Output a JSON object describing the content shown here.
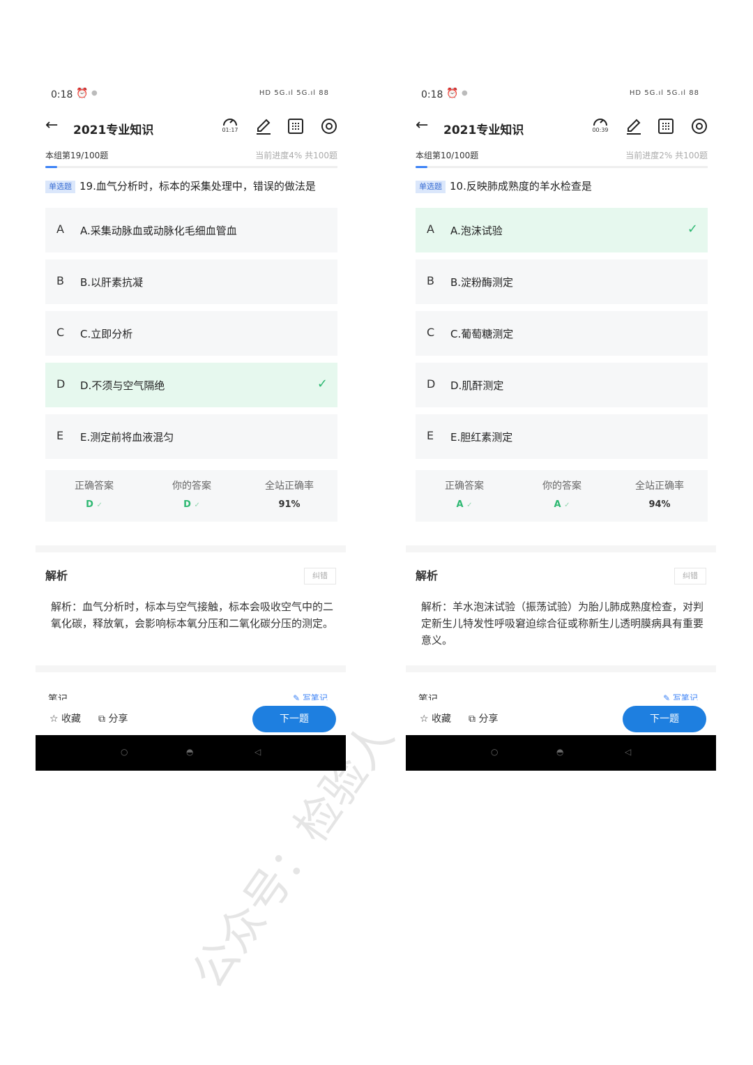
{
  "screens": [
    {
      "status": {
        "time": "0:18",
        "icons": "HD 5G.ıl 5G.ıl 88"
      },
      "title": "2021专业知识",
      "timer": "01:17",
      "group": "本组第19/100题",
      "progress": "当前进度4%  共100题",
      "progress_fraction": 0.04,
      "question_type": "单选题",
      "question": "19.血气分析时，标本的采集处理中，错误的做法是",
      "options": [
        {
          "letter": "A",
          "text": "A.采集动脉血或动脉化毛细血管血",
          "correct": false
        },
        {
          "letter": "B",
          "text": "B.以肝素抗凝",
          "correct": false
        },
        {
          "letter": "C",
          "text": "C.立即分析",
          "correct": false
        },
        {
          "letter": "D",
          "text": "D.不须与空气隔绝",
          "correct": true
        },
        {
          "letter": "E",
          "text": "E.测定前将血液混匀",
          "correct": false
        }
      ],
      "stats": {
        "correct_label": "正确答案",
        "correct_value": "D",
        "yours_label": "你的答案",
        "yours_value": "D",
        "rate_label": "全站正确率",
        "rate_value": "91%"
      },
      "analysis_heading": "解析",
      "report_label": "纠错",
      "analysis_text": "解析：血气分析时，标本与空气接触，标本会吸收空气中的二氧化碳，释放氧，会影响标本氧分压和二氧化碳分压的测定。",
      "notes_label": "笔记",
      "write_note": "写笔记",
      "fav_label": "收藏",
      "share_label": "分享",
      "next_label": "下一题"
    },
    {
      "status": {
        "time": "0:18",
        "icons": "HD 5G.ıl 5G.ıl 88"
      },
      "title": "2021专业知识",
      "timer": "00:39",
      "group": "本组第10/100题",
      "progress": "当前进度2%  共100题",
      "progress_fraction": 0.02,
      "question_type": "单选题",
      "question": "10.反映肺成熟度的羊水检查是",
      "options": [
        {
          "letter": "A",
          "text": "A.泡沫试验",
          "correct": true
        },
        {
          "letter": "B",
          "text": "B.淀粉酶测定",
          "correct": false
        },
        {
          "letter": "C",
          "text": "C.葡萄糖测定",
          "correct": false
        },
        {
          "letter": "D",
          "text": "D.肌酐测定",
          "correct": false
        },
        {
          "letter": "E",
          "text": "E.胆红素测定",
          "correct": false
        }
      ],
      "stats": {
        "correct_label": "正确答案",
        "correct_value": "A",
        "yours_label": "你的答案",
        "yours_value": "A",
        "rate_label": "全站正确率",
        "rate_value": "94%"
      },
      "analysis_heading": "解析",
      "report_label": "纠错",
      "analysis_text": "解析：羊水泡沫试验（振荡试验）为胎儿肺成熟度检查，对判定新生儿特发性呼吸窘迫综合征或称新生儿透明膜病具有重要意义。",
      "notes_label": "笔记",
      "write_note": "写笔记",
      "fav_label": "收藏",
      "share_label": "分享",
      "next_label": "下一题"
    }
  ],
  "watermark": "公众号：检验人"
}
